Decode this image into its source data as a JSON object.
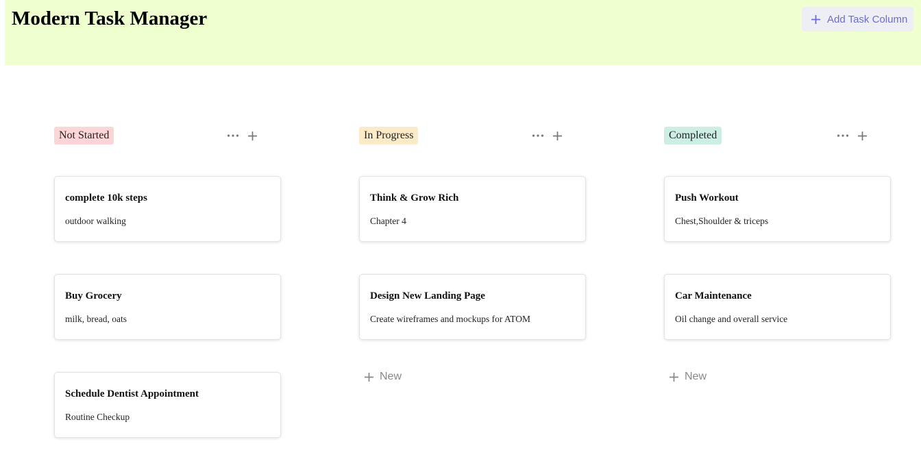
{
  "header": {
    "title": "Modern Task Manager",
    "add_column_label": "Add Task Column",
    "background": "#efffd0"
  },
  "columns": [
    {
      "label": "Not Started",
      "pill_color": "#fcd5d8",
      "cards": [
        {
          "title": "complete 10k steps",
          "description": "outdoor walking"
        },
        {
          "title": "Buy Grocery",
          "description": "milk, bread, oats"
        },
        {
          "title": "Schedule Dentist Appointment",
          "description": "Routine Checkup"
        }
      ]
    },
    {
      "label": "In Progress",
      "pill_color": "#fcebc9",
      "cards": [
        {
          "title": "Think & Grow Rich",
          "description": "Chapter 4"
        },
        {
          "title": "Design New Landing Page",
          "description": "Create wireframes and mockups for ATOM"
        }
      ],
      "new_label": "New"
    },
    {
      "label": "Completed",
      "pill_color": "#cdeee4",
      "cards": [
        {
          "title": "Push Workout",
          "description": "Chest,Shoulder & triceps"
        },
        {
          "title": "Car Maintenance",
          "description": "Oil change and overall service"
        }
      ],
      "new_label": "New"
    }
  ],
  "icons": {
    "more": "more-horizontal-icon",
    "add": "plus-icon"
  }
}
